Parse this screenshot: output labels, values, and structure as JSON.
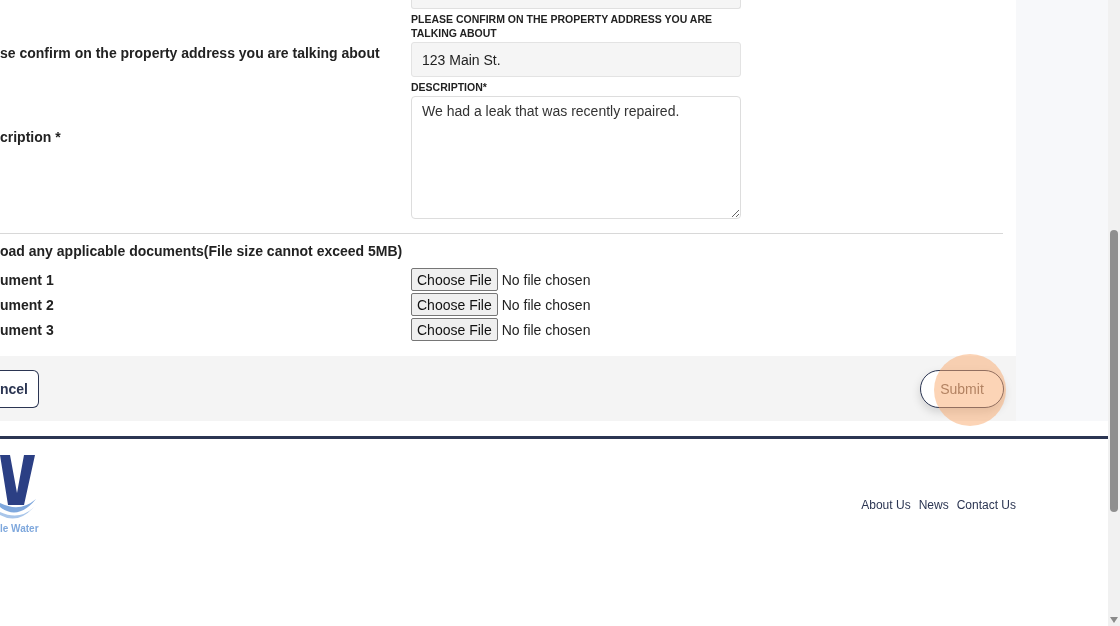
{
  "form": {
    "rows": [
      {
        "kind": "input",
        "side_label": "se confirm on the property address you are talking about",
        "field_label": "PLEASE CONFIRM ON THE PROPERTY ADDRESS YOU ARE TALKING ABOUT",
        "value": "123 Main St."
      },
      {
        "kind": "textarea",
        "side_label": "cription *",
        "field_label": "DESCRIPTION*",
        "value": "We had a leak that was recently repaired."
      }
    ],
    "upload_heading": "oad any applicable documents(File size cannot exceed 5MB)",
    "documents": [
      {
        "label": "ument 1",
        "button": "Choose File",
        "status": "No file chosen"
      },
      {
        "label": "ument 2",
        "button": "Choose File",
        "status": "No file chosen"
      },
      {
        "label": "ument 3",
        "button": "Choose File",
        "status": "No file chosen"
      }
    ]
  },
  "actions": {
    "cancel": "ncel",
    "submit": "Submit"
  },
  "footer": {
    "logo_text": "le Water",
    "links": [
      "About Us",
      "News",
      "Contact Us"
    ]
  }
}
